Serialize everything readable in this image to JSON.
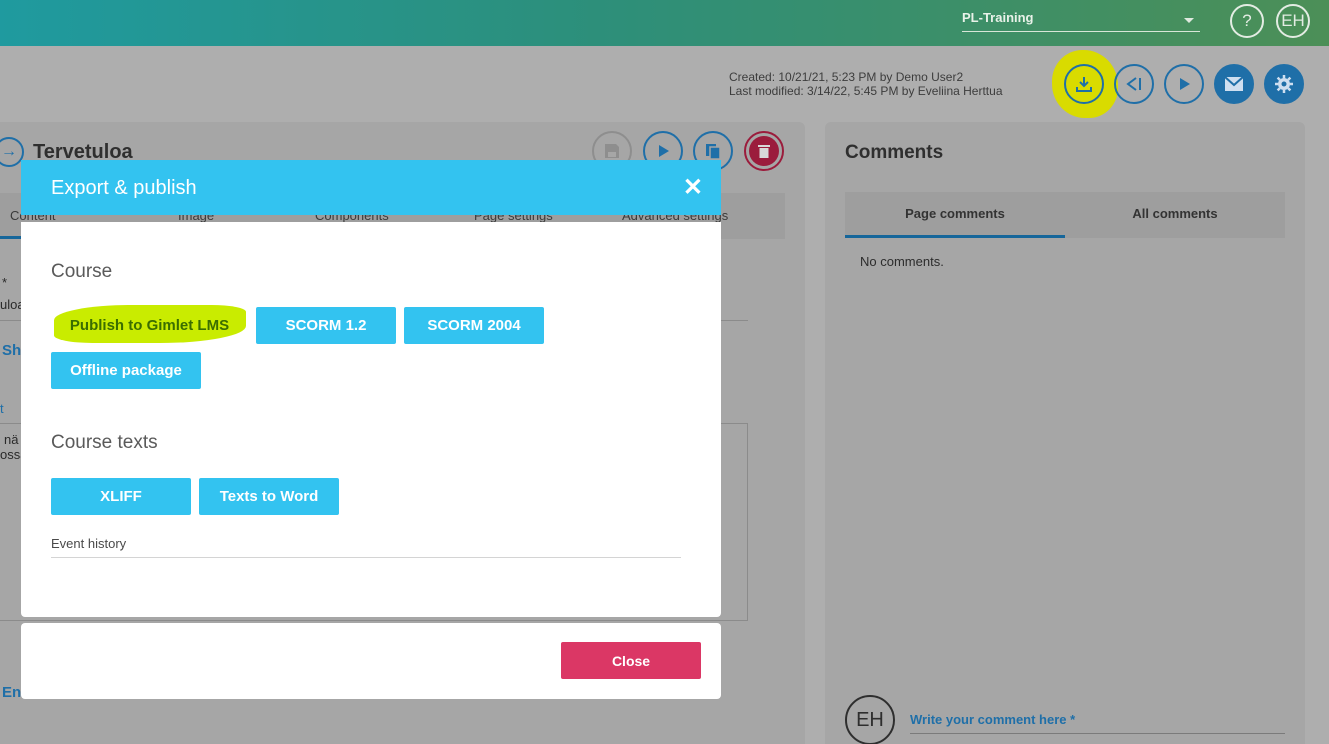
{
  "header": {
    "project_select": "PL-Training",
    "help_label": "?",
    "user_initials": "EH"
  },
  "meta": {
    "created": "Created: 10/21/21, 5:23 PM by Demo User2",
    "modified": "Last modified: 3/14/22, 5:45 PM by Eveliina Herttua"
  },
  "page": {
    "title": "Tervetuloa",
    "tabs": [
      "Content",
      "Image",
      "Components",
      "Page settings",
      "Advanced settings"
    ],
    "fragments": {
      "star": "*",
      "ulo": "uloa",
      "she": "She",
      "t": "t",
      "na": "nä",
      "ossa": "ossä",
      "en": "En"
    }
  },
  "comments": {
    "title": "Comments",
    "tabs": [
      "Page comments",
      "All comments"
    ],
    "empty": "No comments.",
    "avatar": "EH",
    "placeholder": "Write your comment here *"
  },
  "modal": {
    "title": "Export & publish",
    "close_x": "✕",
    "course_title": "Course",
    "course_buttons": [
      "Publish to Gimlet LMS",
      "SCORM 1.2",
      "SCORM 2004",
      "Offline package"
    ],
    "texts_title": "Course texts",
    "texts_buttons": [
      "XLIFF",
      "Texts to Word"
    ],
    "event_history": "Event history",
    "close_button": "Close"
  },
  "colors": {
    "accent": "#33c3f0",
    "close": "#db3765",
    "highlight": "#c9ec00"
  }
}
